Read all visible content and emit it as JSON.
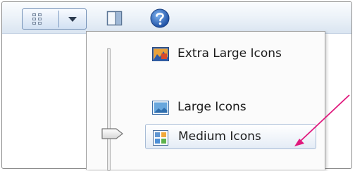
{
  "toolbar": {
    "view_button_icon": "views-grid-icon",
    "view_dropdown_icon": "chevron-down-icon",
    "preview_pane_icon": "preview-pane-icon",
    "help_icon": "help-icon"
  },
  "view_menu": {
    "items": [
      {
        "label": "Extra Large Icons",
        "icon": "extra-large-icons-icon"
      },
      {
        "label": "Large Icons",
        "icon": "large-icons-icon"
      },
      {
        "label": "Medium Icons",
        "icon": "medium-icons-icon",
        "highlighted": true
      }
    ],
    "slider": {
      "selected": "Medium Icons"
    }
  },
  "annotation": {
    "arrow_color": "#e0197d",
    "points_to": "Medium Icons"
  }
}
